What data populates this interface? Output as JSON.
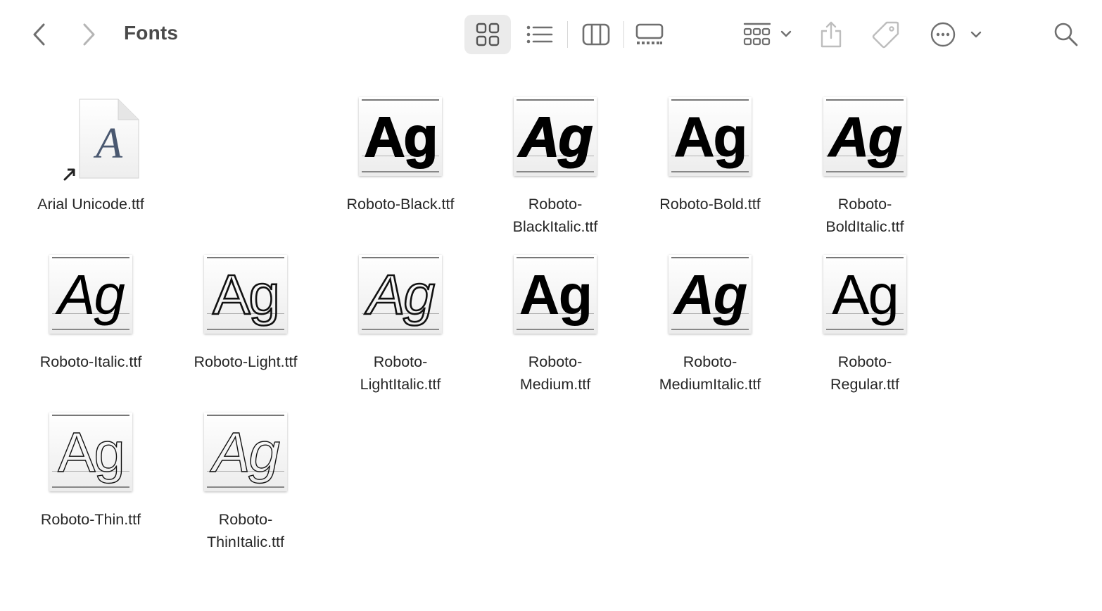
{
  "toolbar": {
    "folder_title": "Fonts",
    "back_icon": "chevron-left-icon",
    "forward_icon": "chevron-right-icon",
    "views": [
      "icon-view",
      "list-view",
      "column-view",
      "gallery-view"
    ],
    "active_view": "icon-view",
    "group_icon": "group-by-icon",
    "share_icon": "share-icon",
    "tag_icon": "tag-icon",
    "more_icon": "ellipsis-circle-icon",
    "search_icon": "search-icon"
  },
  "colors": {
    "accent_active_bg": "#ebebeb",
    "icon_gray": "#6f6f6f",
    "disabled_gray": "#bdbdbd"
  },
  "files": [
    {
      "name": "Arial Unicode.ttf",
      "line1": "Arial Unicode.ttf",
      "line2": "",
      "kind": "alias-document",
      "glyph": "A"
    },
    {
      "name": "Roboto-Black.ttf",
      "line1": "Roboto-Black.ttf",
      "line2": "",
      "kind": "font",
      "glyph": "Ag"
    },
    {
      "name": "Roboto-BlackItalic.ttf",
      "line1": "Roboto-",
      "line2": "BlackItalic.ttf",
      "kind": "font",
      "glyph": "Ag"
    },
    {
      "name": "Roboto-Bold.ttf",
      "line1": "Roboto-Bold.ttf",
      "line2": "",
      "kind": "font",
      "glyph": "Ag"
    },
    {
      "name": "Roboto-BoldItalic.ttf",
      "line1": "Roboto-",
      "line2": "BoldItalic.ttf",
      "kind": "font",
      "glyph": "Ag"
    },
    {
      "name": "Roboto-Italic.ttf",
      "line1": "Roboto-Italic.ttf",
      "line2": "",
      "kind": "font",
      "glyph": "Ag"
    },
    {
      "name": "Roboto-Light.ttf",
      "line1": "Roboto-Light.ttf",
      "line2": "",
      "kind": "font",
      "glyph": "Ag"
    },
    {
      "name": "Roboto-LightItalic.ttf",
      "line1": "Roboto-",
      "line2": "LightItalic.ttf",
      "kind": "font",
      "glyph": "Ag"
    },
    {
      "name": "Roboto-Medium.ttf",
      "line1": "Roboto-",
      "line2": "Medium.ttf",
      "kind": "font",
      "glyph": "Ag"
    },
    {
      "name": "Roboto-MediumItalic.ttf",
      "line1": "Roboto-",
      "line2": "MediumItalic.ttf",
      "kind": "font",
      "glyph": "Ag"
    },
    {
      "name": "Roboto-Regular.ttf",
      "line1": "Roboto-",
      "line2": "Regular.ttf",
      "kind": "font",
      "glyph": "Ag"
    },
    {
      "name": "Roboto-Thin.ttf",
      "line1": "Roboto-Thin.ttf",
      "line2": "",
      "kind": "font",
      "glyph": "Ag"
    },
    {
      "name": "Roboto-ThinItalic.ttf",
      "line1": "Roboto-",
      "line2": "ThinItalic.ttf",
      "kind": "font",
      "glyph": "Ag"
    }
  ]
}
